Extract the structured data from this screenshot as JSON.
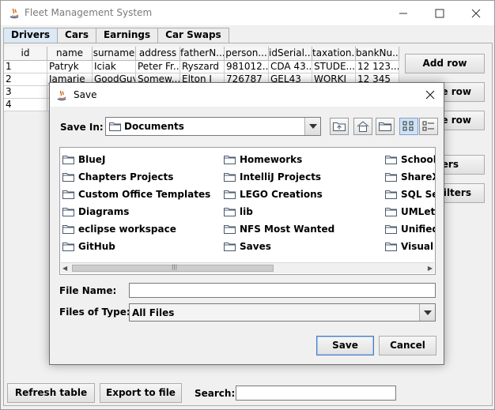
{
  "window": {
    "title": "Fleet Management System"
  },
  "tabs": [
    {
      "label": "Drivers",
      "active": true
    },
    {
      "label": "Cars",
      "active": false
    },
    {
      "label": "Earnings",
      "active": false
    },
    {
      "label": "Car Swaps",
      "active": false
    }
  ],
  "table": {
    "columns": [
      "id",
      "name",
      "surname",
      "address",
      "fatherN...",
      "person...",
      "idSerial...",
      "taxation...",
      "bankNu..."
    ],
    "rows": [
      [
        "1",
        "Patryk",
        "Iciak",
        "Peter Fr...",
        "Ryszard",
        "981012...",
        "CDA 43...",
        "STUDE...",
        "12 123..."
      ],
      [
        "2",
        "Jamarie",
        "GoodGuy",
        "Somew...",
        "Elton J",
        "726787",
        "GEL43",
        "WORKI",
        "12 345"
      ],
      [
        "3",
        "",
        "",
        "",
        "",
        "",
        "",
        "",
        ""
      ],
      [
        "4",
        "",
        "",
        "",
        "",
        "",
        "",
        "",
        ""
      ]
    ]
  },
  "side_buttons": [
    "Add row",
    "e row",
    "e row",
    "ers",
    "filters"
  ],
  "bottom": {
    "refresh_label": "Refresh table",
    "export_label": "Export to file",
    "search_label": "Search:",
    "search_value": ""
  },
  "dialog": {
    "title": "Save",
    "save_in_label": "Save In:",
    "save_in_value": "Documents",
    "files": [
      [
        "BlueJ",
        "Chapters Projects",
        "Custom Office Templates",
        "Diagrams",
        "eclipse workspace",
        "GitHub"
      ],
      [
        "Homeworks",
        "IntelliJ Projects",
        "LEGO Creations",
        "lib",
        "NFS Most Wanted",
        "Saves"
      ],
      [
        "School P",
        "ShareX",
        "SQL Ser",
        "UMLet",
        "Unified I",
        "Visual S"
      ]
    ],
    "file_name_label": "File Name:",
    "file_name_value": "",
    "file_type_label": "Files of Type:",
    "file_type_value": "All Files",
    "save_label": "Save",
    "cancel_label": "Cancel"
  },
  "colors": {
    "tab_active": "#dbe8f6",
    "folder": "#4a5a6e"
  }
}
